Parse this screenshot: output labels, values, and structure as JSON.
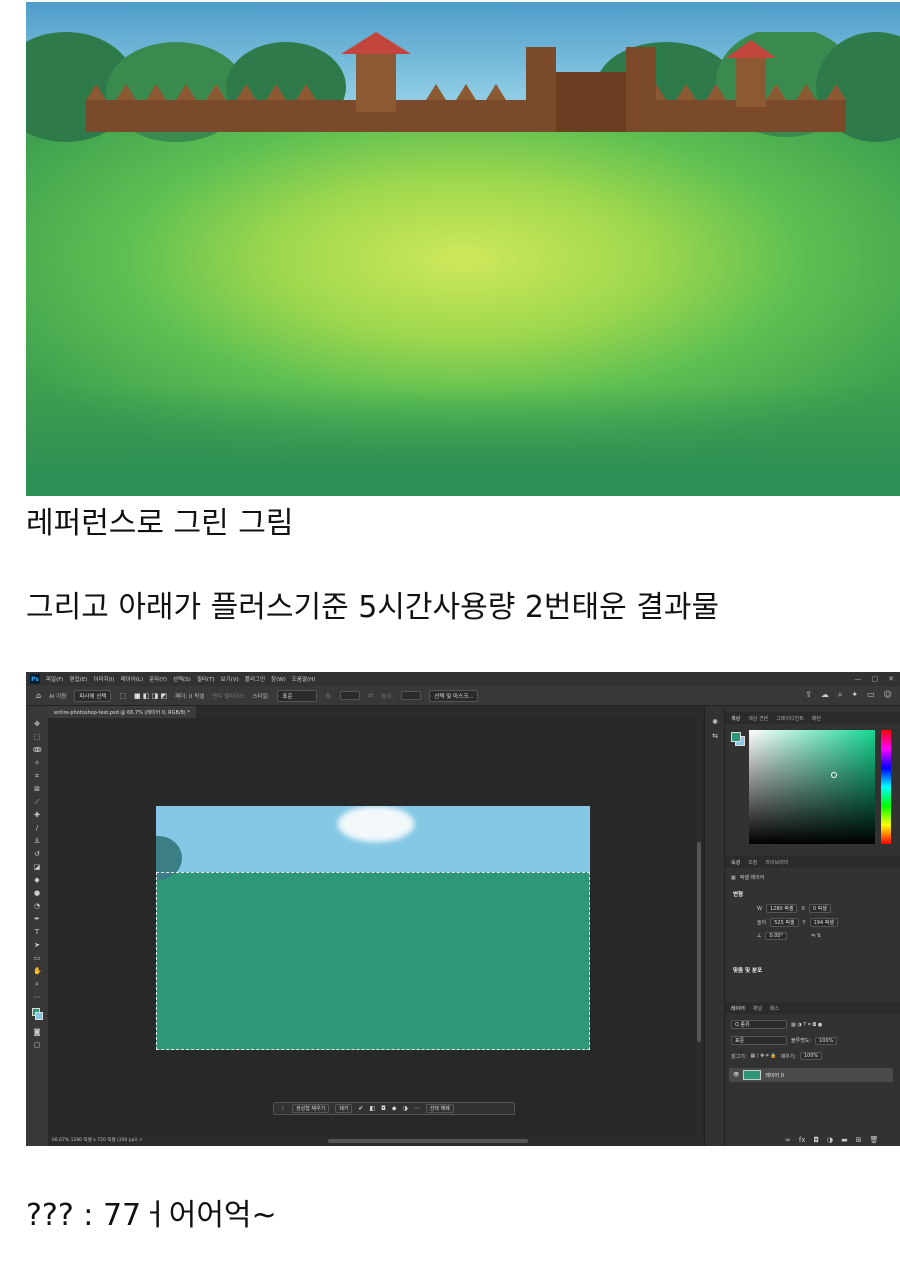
{
  "captions": {
    "reference": "레퍼런스로 그린 그림",
    "result_note": "그리고 아래가 플러스기준 5시간사용량 2번태운 결과물",
    "reaction": "??? : 77ㅓ어어억~"
  },
  "photoshop": {
    "logo": "Ps",
    "menu": [
      "파일(F)",
      "편집(E)",
      "이미지(I)",
      "레이어(L)",
      "문자(Y)",
      "선택(S)",
      "필터(T)",
      "보기(V)",
      "플러그인",
      "창(W)",
      "도움말(H)"
    ],
    "window_controls": [
      "—",
      "▢",
      "✕"
    ],
    "options": {
      "ai_support": "AI 지원",
      "select_subject": "피사체 선택",
      "feather": "페더: 0 픽셀",
      "anti_alias": "앤티 앨리어스",
      "style_label": "스타일:",
      "style_value": "표준",
      "width_label": "폭:",
      "height_label": "높이:",
      "select_mask": "선택 및 마스크..."
    },
    "doc_tab": "entire-photoshop-test.psd @ 66.7% (레이어 0, RGB/8) *",
    "context_bar": {
      "generative_fill": "생성형 채우기",
      "remove": "제거",
      "deselect": "선택 해제"
    },
    "status": "66.67%   1280 픽셀 x 720 픽셀 (300 ppi)   >",
    "color_panel_tabs": [
      "색상",
      "색상 견본",
      "그레이디언트",
      "패턴"
    ],
    "properties_tabs": [
      "속성",
      "조정",
      "라이브러리"
    ],
    "properties": {
      "layer_type": "픽셀 레이어",
      "transform_title": "변형",
      "width_label": "W",
      "width_value": "1280 픽셀",
      "x_label": "X",
      "x_value": "0 픽셀",
      "height_label": "높이",
      "height_value": "525 픽셀",
      "y_label": "Y",
      "y_value": "194 픽셀",
      "angle": "0.00°",
      "align_title": "맞춤 및 분포"
    },
    "layers_tabs": [
      "레이어",
      "채널",
      "패스"
    ],
    "layers": {
      "filter_kind": "Q 종류",
      "blend_mode": "표준",
      "opacity_label": "불투명도:",
      "opacity_value": "100%",
      "lock_label": "잠그기:",
      "fill_label": "채우기:",
      "fill_value": "100%",
      "layer_name": "레이어 0"
    }
  },
  "colors": {
    "canvas_green": "#2e9679",
    "canvas_sky": "#84c8e6",
    "ps_bg": "#2b2b2b",
    "ps_panel": "#323232"
  }
}
